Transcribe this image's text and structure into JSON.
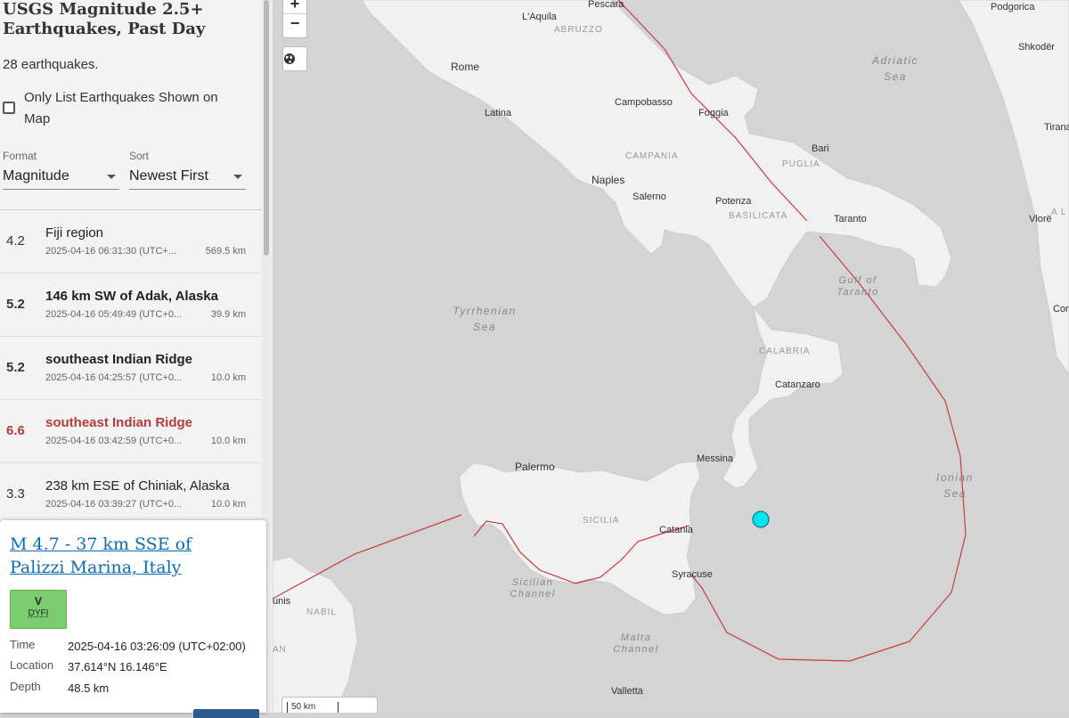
{
  "panel": {
    "title": "USGS Magnitude 2.5+ Earthquakes, Past Day",
    "count_text": "28 earthquakes.",
    "filter_label": "Only List Earthquakes Shown on Map",
    "format_caption": "Format",
    "format_value": "Magnitude",
    "sort_caption": "Sort",
    "sort_value": "Newest First"
  },
  "earthquakes": [
    {
      "mag": "4.2",
      "place": "Fiji region",
      "time": "2025-04-16 06:31:30 (UTC+...",
      "depth": "569.5 km"
    },
    {
      "mag": "5.2",
      "place": "146 km SW of Adak, Alaska",
      "time": "2025-04-16 05:49:49 (UTC+0...",
      "depth": "39.9 km"
    },
    {
      "mag": "5.2",
      "place": "southeast Indian Ridge",
      "time": "2025-04-16 04:25:57 (UTC+0...",
      "depth": "10.0 km"
    },
    {
      "mag": "6.6",
      "place": "southeast Indian Ridge",
      "time": "2025-04-16 03:42:59 (UTC+0...",
      "depth": "10.0 km"
    },
    {
      "mag": "3.3",
      "place": "238 km ESE of Chiniak, Alaska",
      "time": "2025-04-16 03:39:27 (UTC+0...",
      "depth": "10.0 km"
    }
  ],
  "popup": {
    "title": "M 4.7 - 37 km SSE of Palizzi Marina, Italy",
    "dyfi_level": "V",
    "dyfi_label": "DYFI",
    "time_label": "Time",
    "time_value": "2025-04-16 03:26:09 (UTC+02:00)",
    "location_label": "Location",
    "location_value": "37.614°N 16.146°E",
    "depth_label": "Depth",
    "depth_value": "48.5 km"
  },
  "map": {
    "zoom_in": "+",
    "zoom_out": "−",
    "globe_icon": "globe-icon",
    "scale": "50 km",
    "colors": {
      "land": "#f1f1f1",
      "water": "#d4d4d4",
      "fault": "#c83c3c",
      "marker": "#00e5ee"
    },
    "labels": {
      "pescara": "Pescara",
      "laquila": "L'Aquila",
      "abruzzo": "ABRUZZO",
      "rome": "Rome",
      "latina": "Latina",
      "campobasso": "Campobasso",
      "foggia": "Foggia",
      "campania": "CAMPANIA",
      "naples": "Naples",
      "salerno": "Salerno",
      "potenza": "Potenza",
      "basilicata": "BASILICATA",
      "bari": "Bari",
      "puglia": "PUGLIA",
      "taranto": "Taranto",
      "adriatic": "Adriatic Sea",
      "podgorica": "Podgorica",
      "shkoder": "Shkodër",
      "tirana": "Tirana",
      "vlore": "Vlorë",
      "al": "A L",
      "cor": "Cor",
      "tyrrhenian": "Tyrrhenian Sea",
      "gulf": "Gulf of Taranto",
      "calabria": "CALABRIA",
      "catanzaro": "Catanzaro",
      "ionian": "Ionian Sea",
      "messina": "Messina",
      "palermo": "Palermo",
      "sicilia": "SICILIA",
      "catania": "Catania",
      "syracuse": "Syracuse",
      "sicilian": "Sicilian Channel",
      "malta": "Malta Channel",
      "valletta": "Valletta",
      "tunis": "unis",
      "nabil": "NABIL",
      "an": "AN"
    }
  }
}
